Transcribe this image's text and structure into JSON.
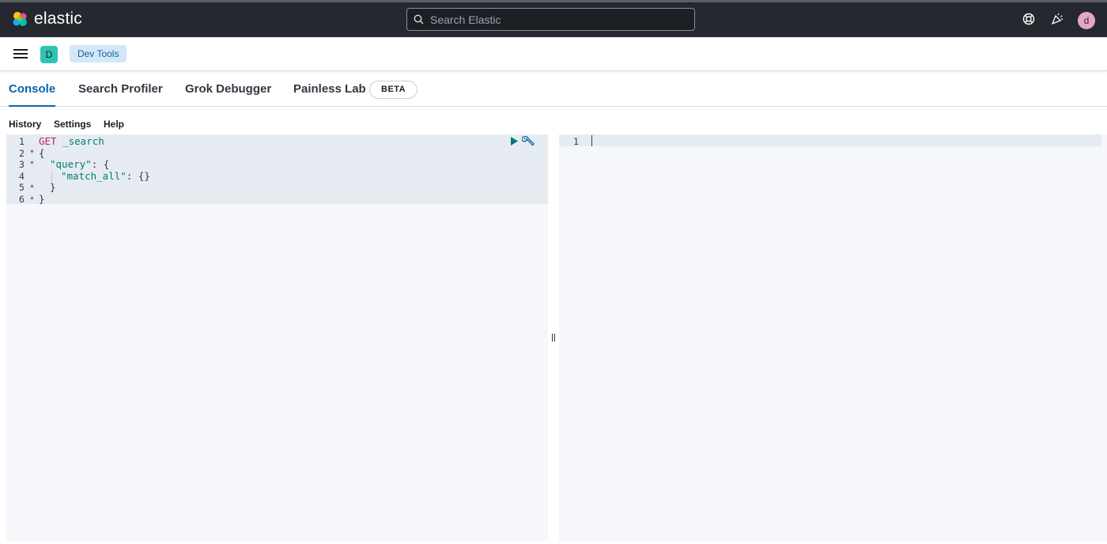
{
  "header": {
    "brand": "elastic",
    "search_placeholder": "Search Elastic",
    "user_initial": "d",
    "icons": [
      "help-icon",
      "newsfeed-icon"
    ]
  },
  "subheader": {
    "space_initial": "D",
    "breadcrumb": "Dev Tools"
  },
  "tabs": [
    {
      "label": "Console",
      "active": true
    },
    {
      "label": "Search Profiler",
      "active": false
    },
    {
      "label": "Grok Debugger",
      "active": false
    },
    {
      "label": "Painless Lab",
      "active": false
    }
  ],
  "beta_badge": "BETA",
  "console_menu": [
    "History",
    "Settings",
    "Help"
  ],
  "request_editor": {
    "line_numbers": [
      "1",
      "2",
      "3",
      "4",
      "5",
      "6"
    ],
    "method": "GET",
    "path": "_search",
    "lines": [
      "{",
      "\"query\"",
      ": {",
      "\"match_all\"",
      ": {}",
      "}",
      "}"
    ]
  },
  "response_editor": {
    "line_numbers": [
      "1"
    ]
  },
  "colors": {
    "header_bg": "#25282f",
    "accent": "#0b64a8",
    "method": "#c61e69",
    "string": "#017d73",
    "play": "#017d73"
  }
}
